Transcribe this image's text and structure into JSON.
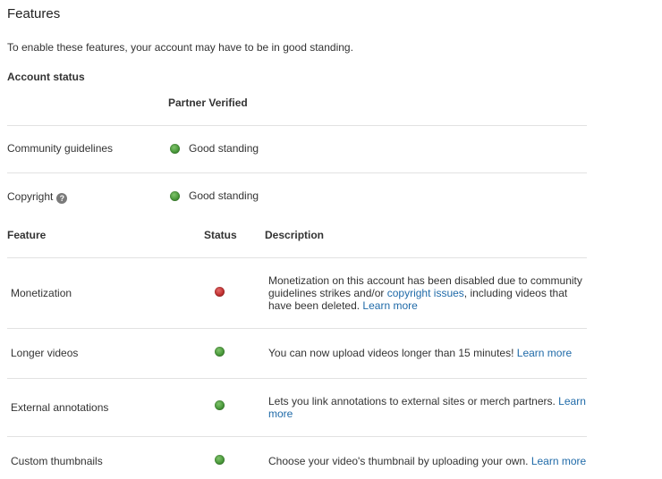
{
  "page": {
    "title": "Features",
    "intro": "To enable these features, your account may have to be in good standing."
  },
  "account_status": {
    "title": "Account status",
    "partner_label": "Partner Verified",
    "rows": [
      {
        "label": "Community guidelines",
        "status": "Good standing",
        "status_color": "#4a9a3b"
      },
      {
        "label": "Copyright",
        "status": "Good standing",
        "status_color": "#4a9a3b",
        "help_icon": "question-circle-icon"
      }
    ]
  },
  "features_table": {
    "headers": {
      "feature": "Feature",
      "status": "Status",
      "description": "Description"
    },
    "rows": [
      {
        "name": "Monetization",
        "status_color": "#c23030",
        "desc_1": "Monetization on this account has been disabled due to community guidelines strikes and/or ",
        "desc_link": "copyright issues",
        "desc_2": ", including videos that have been deleted. ",
        "learn_more": "Learn more"
      },
      {
        "name": "Longer videos",
        "status_color": "#4a9a3b",
        "desc_1": "You can now upload videos longer than 15 minutes! ",
        "learn_more": "Learn more"
      },
      {
        "name": "External annotations",
        "status_color": "#4a9a3b",
        "desc_1": "Lets you link annotations to external sites or merch partners. ",
        "learn_more": "Learn more"
      },
      {
        "name": "Custom thumbnails",
        "status_color": "#4a9a3b",
        "desc_1": "Choose your video's thumbnail by uploading your own. ",
        "learn_more": "Learn more"
      }
    ]
  },
  "colors": {
    "link": "#1f6aa8",
    "good": "#4a9a3b",
    "bad": "#c23030",
    "divider": "#e2e2e2"
  }
}
